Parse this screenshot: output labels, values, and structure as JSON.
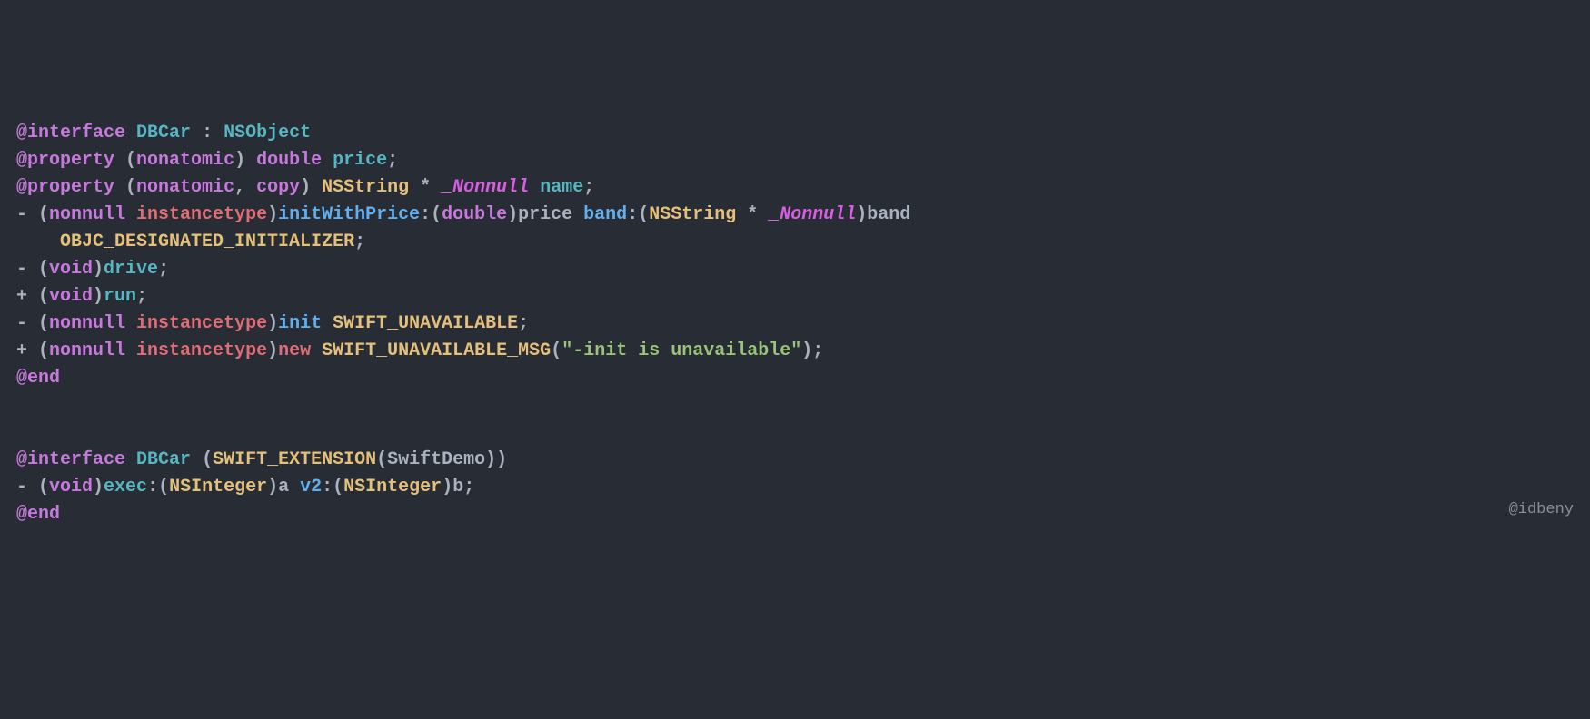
{
  "code": {
    "l1": {
      "at": "@interface",
      "cls": "DBCar",
      "colon": " : ",
      "sup": "NSObject"
    },
    "l2": {
      "at": "@property",
      "open": " (",
      "a1": "nonatomic",
      "close": ") ",
      "type": "double",
      "sp": " ",
      "name": "price",
      "semi": ";"
    },
    "l3": {
      "at": "@property",
      "open": " (",
      "a1": "nonatomic",
      "comma": ", ",
      "a2": "copy",
      "close": ") ",
      "ns": "NSString",
      "star": " * ",
      "nn": "_Nonnull",
      "sp": " ",
      "name": "name",
      "semi": ";"
    },
    "l4": {
      "dash": "- (",
      "nonnull": "nonnull",
      "sp1": " ",
      "inst": "instancetype",
      "close1": ")",
      "m1": "initWithPrice",
      "colon1": ":(",
      "dbl": "double",
      "close2": ")price ",
      "m2": "band",
      "colon2": ":(",
      "ns": "NSString",
      "star": " * ",
      "nn": "_Nonnull",
      "close3": ")band"
    },
    "l5": {
      "indent": "    ",
      "macro": "OBJC_DESIGNATED_INITIALIZER",
      "semi": ";"
    },
    "l6": {
      "dash": "- (",
      "void": "void",
      "close": ")",
      "m": "drive",
      "semi": ";"
    },
    "l7": {
      "plus": "+ (",
      "void": "void",
      "close": ")",
      "m": "run",
      "semi": ";"
    },
    "l8": {
      "dash": "- (",
      "nonnull": "nonnull",
      "sp": " ",
      "inst": "instancetype",
      "close": ")",
      "m": "init",
      "sp2": " ",
      "macro": "SWIFT_UNAVAILABLE",
      "semi": ";"
    },
    "l9": {
      "plus": "+ (",
      "nonnull": "nonnull",
      "sp": " ",
      "inst": "instancetype",
      "close": ")",
      "m": "new",
      "sp2": " ",
      "macro": "SWIFT_UNAVAILABLE_MSG",
      "open": "(",
      "str": "\"-init is unavailable\"",
      "close2": ");"
    },
    "l10": {
      "at": "@end"
    },
    "l11": "",
    "l12": "",
    "l13": {
      "at": "@interface",
      "sp": " ",
      "cls": "DBCar",
      "open": " (",
      "macro": "SWIFT_EXTENSION",
      "open2": "(",
      "arg": "SwiftDemo",
      "close": "))"
    },
    "l14": {
      "dash": "- (",
      "void": "void",
      "close": ")",
      "m1": "exec",
      "colon1": ":(",
      "ns1": "NSInteger",
      "close1": ")a ",
      "m2": "v2",
      "colon2": ":(",
      "ns2": "NSInteger",
      "close2": ")b;"
    },
    "l15": {
      "at": "@end"
    }
  },
  "watermark": "@idbeny"
}
